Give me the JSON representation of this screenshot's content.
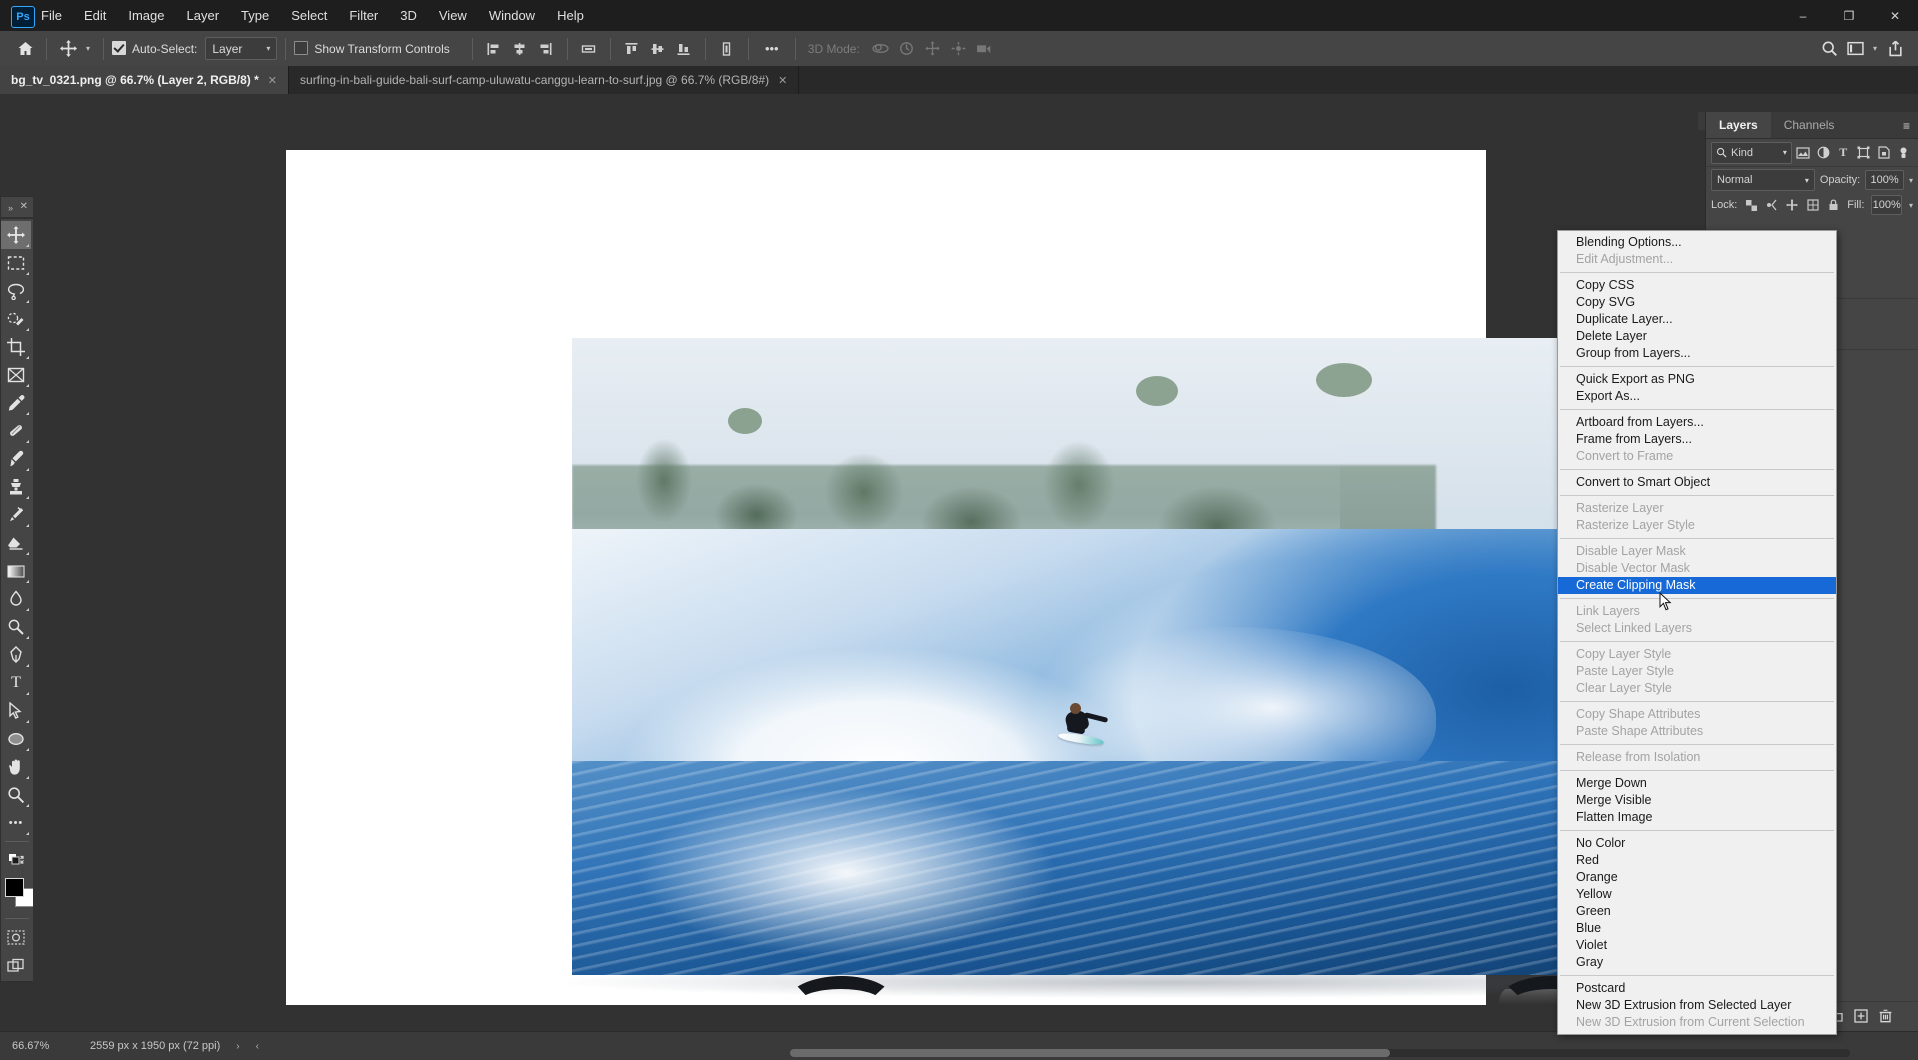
{
  "app": {
    "name": "Adobe Photoshop",
    "logo": "Ps"
  },
  "menubar": {
    "items": [
      "File",
      "Edit",
      "Image",
      "Layer",
      "Type",
      "Select",
      "Filter",
      "3D",
      "View",
      "Window",
      "Help"
    ]
  },
  "window_controls": {
    "minimize": "–",
    "restore": "❐",
    "close": "✕"
  },
  "options_bar": {
    "home_icon": "home-icon",
    "tool_icon": "move-tool-icon",
    "auto_select_label": "Auto-Select:",
    "auto_select_checked": true,
    "layer_select_value": "Layer",
    "show_transform_label": "Show Transform Controls",
    "show_transform_checked": false,
    "more_label": "•••",
    "mode3d_label": "3D Mode:",
    "right_icons": [
      "search-icon",
      "workspace-icon",
      "chevron-down-icon",
      "share-icon"
    ]
  },
  "tabs": [
    {
      "title": "bg_tv_0321.png @ 66.7% (Layer 2, RGB/8) *",
      "active": true,
      "close": "✕"
    },
    {
      "title": "surfing-in-bali-guide-bali-surf-camp-uluwatu-canggu-learn-to-surf.jpg @ 66.7% (RGB/8#)",
      "active": false,
      "close": "✕"
    }
  ],
  "toolbar": {
    "collapse_icon": "»",
    "close_icon": "✕",
    "tools": [
      {
        "name": "move-tool",
        "glyph": "✛",
        "selected": true
      },
      {
        "name": "rectangular-marquee-tool",
        "glyph": "⬚",
        "selected": false
      },
      {
        "name": "lasso-tool",
        "glyph": "⊃",
        "selected": false
      },
      {
        "name": "quick-selection-tool",
        "glyph": "✒",
        "selected": false
      },
      {
        "name": "crop-tool",
        "glyph": "⌗",
        "selected": false
      },
      {
        "name": "frame-tool",
        "glyph": "⌧",
        "selected": false
      },
      {
        "name": "eyedropper-tool",
        "glyph": "✐",
        "selected": false
      },
      {
        "name": "healing-brush-tool",
        "glyph": "✇",
        "selected": false
      },
      {
        "name": "brush-tool",
        "glyph": "✎",
        "selected": false
      },
      {
        "name": "clone-stamp-tool",
        "glyph": "⚑",
        "selected": false
      },
      {
        "name": "history-brush-tool",
        "glyph": "✄",
        "selected": false
      },
      {
        "name": "eraser-tool",
        "glyph": "◰",
        "selected": false
      },
      {
        "name": "gradient-tool",
        "glyph": "▤",
        "selected": false
      },
      {
        "name": "blur-tool",
        "glyph": "◌",
        "selected": false
      },
      {
        "name": "dodge-tool",
        "glyph": "⚲",
        "selected": false
      },
      {
        "name": "pen-tool",
        "glyph": "✑",
        "selected": false
      },
      {
        "name": "type-tool",
        "glyph": "T",
        "selected": false
      },
      {
        "name": "path-selection-tool",
        "glyph": "➤",
        "selected": false
      },
      {
        "name": "ellipse-tool",
        "glyph": "⬭",
        "selected": false
      },
      {
        "name": "hand-tool",
        "glyph": "✋",
        "selected": false
      },
      {
        "name": "zoom-tool",
        "glyph": "⚲",
        "selected": false
      },
      {
        "name": "edit-toolbar",
        "glyph": "•••",
        "selected": false
      }
    ],
    "quickmask_icon": "quick-mask-icon",
    "screenmode_icon": "screen-mode-icon",
    "foreground_color": "#000000",
    "background_color": "#ffffff"
  },
  "float_panels": [
    {
      "name": "history-panel",
      "collapse": "»",
      "close": "✕",
      "icons": [
        "history-icon",
        "play-icon"
      ]
    },
    {
      "name": "brush-presets-panel",
      "collapse": "»",
      "close": "✕",
      "icons": [
        "brush-presets-icon"
      ]
    }
  ],
  "layers_panel": {
    "dock_collapse": "«",
    "dock_close": "✕",
    "tabs": [
      {
        "label": "Layers",
        "active": true
      },
      {
        "label": "Channels",
        "active": false
      }
    ],
    "menu_icon": "≡",
    "filter": {
      "search_icon": "search-icon",
      "kind_label": "Kind",
      "chevron": "⌄",
      "type_icons": [
        "pixel-filter-icon",
        "adjustment-filter-icon",
        "type-filter-icon",
        "shape-filter-icon",
        "smartobject-filter-icon",
        "filter-toggle-icon"
      ]
    },
    "blend_mode": "Normal",
    "opacity_label": "Opacity:",
    "opacity_value": "100%",
    "fill_label": "Fill:",
    "fill_value": "100%",
    "lock_label": "Lock:",
    "footer_icons": [
      "link-icon",
      "fx-icon",
      "mask-icon",
      "adjustment-icon",
      "group-icon",
      "new-layer-icon",
      "delete-layer-icon"
    ]
  },
  "status_bar": {
    "zoom": "66.67%",
    "doc_size": "2559 px x 1950 px (72 ppi)",
    "arrow_right": "›",
    "arrow_left": "‹"
  },
  "context_menu": {
    "groups": [
      [
        {
          "label": "Blending Options...",
          "state": "normal"
        },
        {
          "label": "Edit Adjustment...",
          "state": "disabled"
        }
      ],
      [
        {
          "label": "Copy CSS",
          "state": "normal"
        },
        {
          "label": "Copy SVG",
          "state": "normal"
        },
        {
          "label": "Duplicate Layer...",
          "state": "normal"
        },
        {
          "label": "Delete Layer",
          "state": "normal"
        },
        {
          "label": "Group from Layers...",
          "state": "normal"
        }
      ],
      [
        {
          "label": "Quick Export as PNG",
          "state": "normal"
        },
        {
          "label": "Export As...",
          "state": "normal"
        }
      ],
      [
        {
          "label": "Artboard from Layers...",
          "state": "normal"
        },
        {
          "label": "Frame from Layers...",
          "state": "normal"
        },
        {
          "label": "Convert to Frame",
          "state": "disabled"
        }
      ],
      [
        {
          "label": "Convert to Smart Object",
          "state": "normal"
        }
      ],
      [
        {
          "label": "Rasterize Layer",
          "state": "disabled"
        },
        {
          "label": "Rasterize Layer Style",
          "state": "disabled"
        }
      ],
      [
        {
          "label": "Disable Layer Mask",
          "state": "disabled"
        },
        {
          "label": "Disable Vector Mask",
          "state": "disabled"
        },
        {
          "label": "Create Clipping Mask",
          "state": "highlighted"
        }
      ],
      [
        {
          "label": "Link Layers",
          "state": "disabled"
        },
        {
          "label": "Select Linked Layers",
          "state": "disabled"
        }
      ],
      [
        {
          "label": "Copy Layer Style",
          "state": "disabled"
        },
        {
          "label": "Paste Layer Style",
          "state": "disabled"
        },
        {
          "label": "Clear Layer Style",
          "state": "disabled"
        }
      ],
      [
        {
          "label": "Copy Shape Attributes",
          "state": "disabled"
        },
        {
          "label": "Paste Shape Attributes",
          "state": "disabled"
        }
      ],
      [
        {
          "label": "Release from Isolation",
          "state": "disabled"
        }
      ],
      [
        {
          "label": "Merge Down",
          "state": "normal"
        },
        {
          "label": "Merge Visible",
          "state": "normal"
        },
        {
          "label": "Flatten Image",
          "state": "normal"
        }
      ],
      [
        {
          "label": "No Color",
          "state": "normal"
        },
        {
          "label": "Red",
          "state": "normal"
        },
        {
          "label": "Orange",
          "state": "normal"
        },
        {
          "label": "Yellow",
          "state": "normal"
        },
        {
          "label": "Green",
          "state": "normal"
        },
        {
          "label": "Blue",
          "state": "normal"
        },
        {
          "label": "Violet",
          "state": "normal"
        },
        {
          "label": "Gray",
          "state": "normal"
        }
      ],
      [
        {
          "label": "Postcard",
          "state": "normal"
        },
        {
          "label": "New 3D Extrusion from Selected Layer",
          "state": "normal"
        },
        {
          "label": "New 3D Extrusion from Current Selection",
          "state": "disabled"
        }
      ]
    ],
    "highlight_color": "#1669d6"
  },
  "canvas": {
    "description": "White artboard showing a flat-screen TV displaying a surfer riding a large blue barrel wave with tropical treeline",
    "background_color": "#ffffff"
  }
}
